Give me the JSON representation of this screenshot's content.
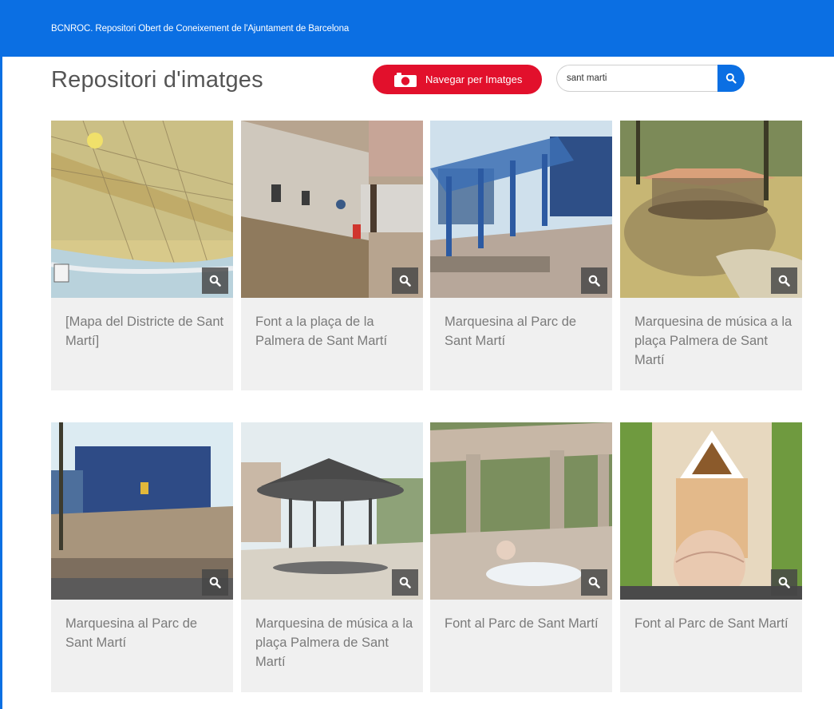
{
  "header": {
    "site_name": "BCNROC. Repositori Obert de Coneixement de l'Ajuntament de Barcelona"
  },
  "page": {
    "title": "Repositori d'imatges"
  },
  "toolbar": {
    "browse_label": "Navegar per Imatges"
  },
  "search": {
    "value": "sant marti",
    "placeholder": ""
  },
  "icons": {
    "browse": "camera-icon",
    "search": "search-icon",
    "zoom": "magnifier-icon"
  },
  "colors": {
    "brand_blue": "#0b6fe3",
    "accent_red": "#e2102c",
    "card_bg": "#f0f0f0",
    "caption_text": "#7a7a7a"
  },
  "results": [
    {
      "caption": "[Mapa del Districte de Sant Martí]"
    },
    {
      "caption": "Font a la plaça de la Palmera de Sant Martí"
    },
    {
      "caption": "Marquesina al Parc de Sant Martí"
    },
    {
      "caption": "Marquesina de música a la plaça Palmera de Sant Martí"
    },
    {
      "caption": "Marquesina al Parc de Sant Martí"
    },
    {
      "caption": "Marquesina de música a la plaça Palmera de Sant Martí"
    },
    {
      "caption": "Font al Parc de Sant Martí"
    },
    {
      "caption": "Font al Parc de Sant Martí"
    }
  ]
}
